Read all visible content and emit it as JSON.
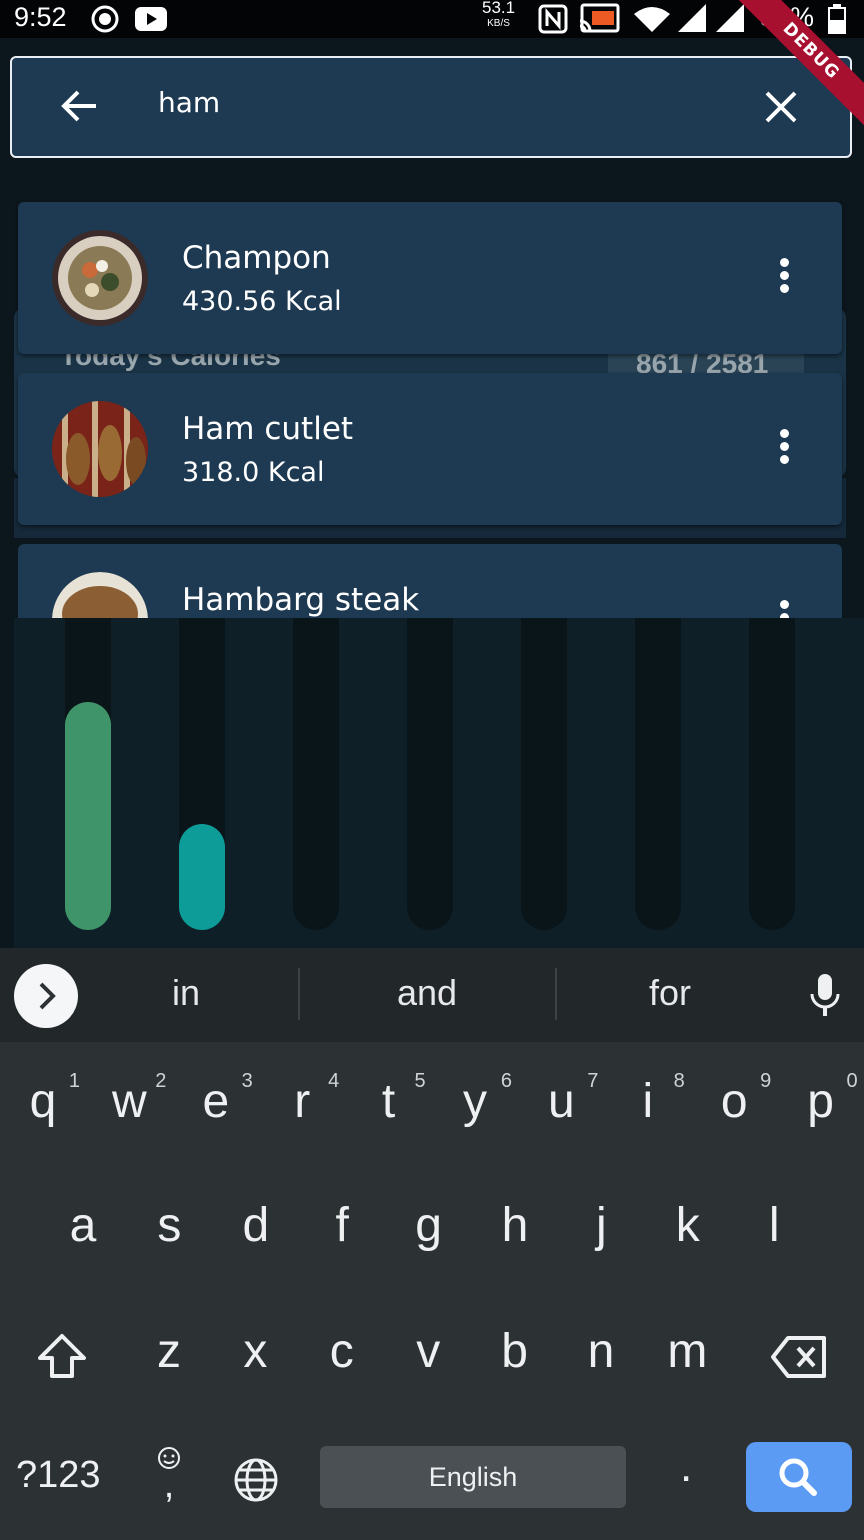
{
  "status_bar": {
    "time": "9:52",
    "net_speed": "53.1",
    "net_speed_unit": "KB/S",
    "battery": "38%",
    "debug_label": "DEBUG"
  },
  "search": {
    "query": "ham",
    "back_icon": "arrow-left-icon",
    "clear_icon": "close-icon"
  },
  "background_card": {
    "title": "Today's Calories",
    "value": "861 / 2581"
  },
  "results": [
    {
      "name": "Champon",
      "kcal": "430.56  Kcal"
    },
    {
      "name": "Ham cutlet",
      "kcal": "318.0  Kcal"
    },
    {
      "name": "Hambarg steak",
      "kcal": ""
    }
  ],
  "chart_data": {
    "type": "bar",
    "categories": [
      "",
      "",
      "",
      "",
      "",
      "",
      ""
    ],
    "values": [
      0.73,
      0.34,
      0,
      0,
      0,
      0,
      0
    ],
    "colors": [
      "#3f9569",
      "#0e9c99",
      "#0a1519",
      "#0a1519",
      "#0a1519",
      "#0a1519",
      "#0a1519"
    ],
    "title": "",
    "xlabel": "",
    "ylabel": "",
    "ylim": [
      0,
      1
    ]
  },
  "keyboard": {
    "suggestions": [
      "in",
      "and",
      "for"
    ],
    "row1": [
      [
        "q",
        "1"
      ],
      [
        "w",
        "2"
      ],
      [
        "e",
        "3"
      ],
      [
        "r",
        "4"
      ],
      [
        "t",
        "5"
      ],
      [
        "y",
        "6"
      ],
      [
        "u",
        "7"
      ],
      [
        "i",
        "8"
      ],
      [
        "o",
        "9"
      ],
      [
        "p",
        "0"
      ]
    ],
    "row2": [
      "a",
      "s",
      "d",
      "f",
      "g",
      "h",
      "j",
      "k",
      "l"
    ],
    "row3": [
      "z",
      "x",
      "c",
      "v",
      "b",
      "n",
      "m"
    ],
    "symbols_key": "?123",
    "comma_key": ",",
    "period_key": ".",
    "space_label": "English",
    "accent": "#5b9bf4"
  }
}
